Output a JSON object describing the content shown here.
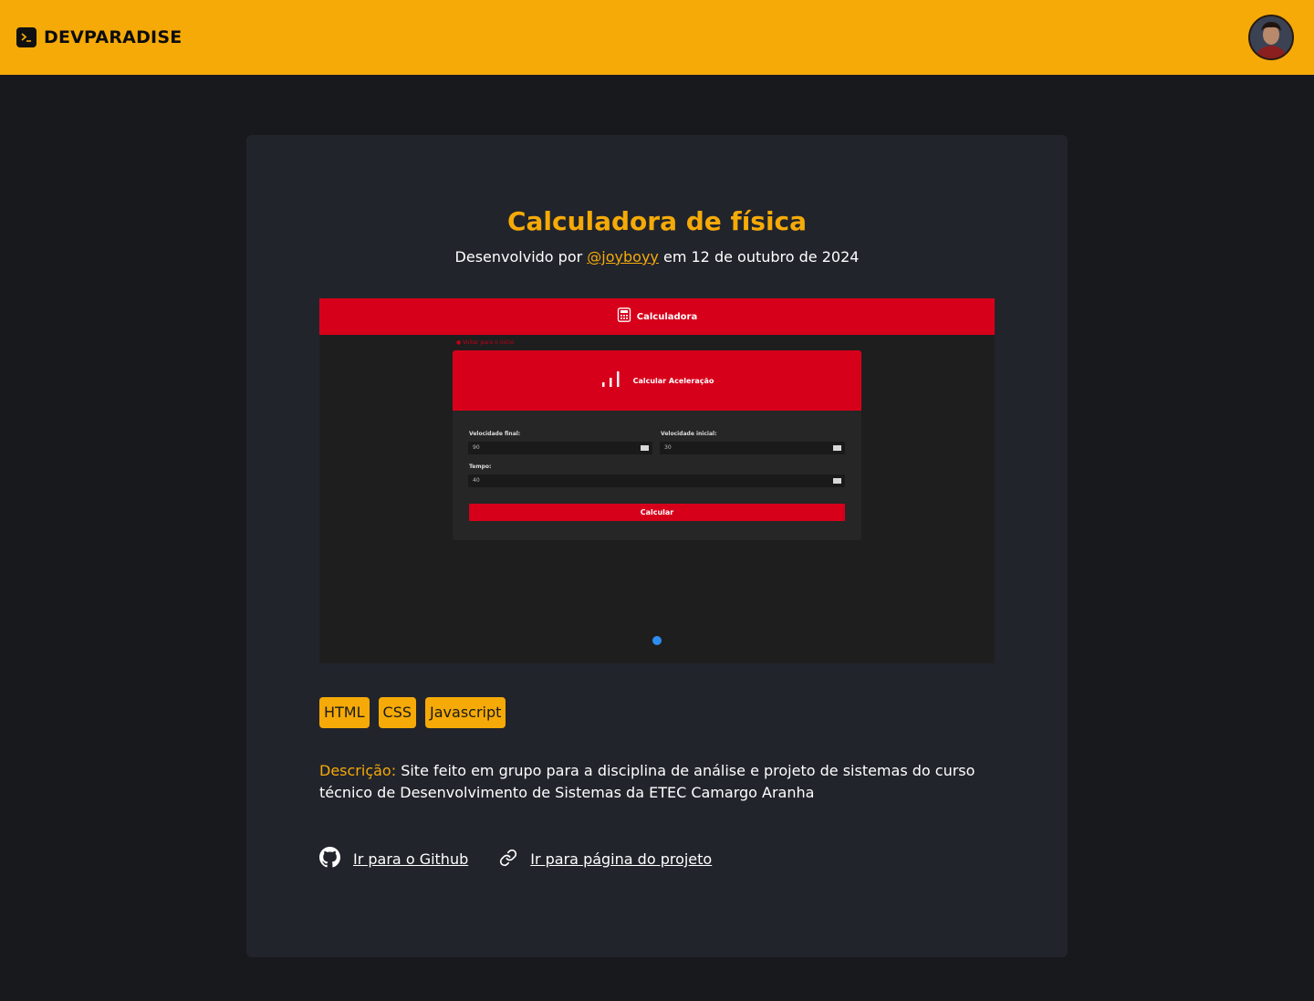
{
  "header": {
    "brand": "DEVPARADISE",
    "colors": {
      "accent": "#f5aa08",
      "background": "#18191d",
      "card": "#22242c"
    }
  },
  "project": {
    "title": "Calculadora de física",
    "byline_prefix": "Desenvolvido por",
    "author": "@joyboyy",
    "byline_suffix": "em 12 de outubro de 2024",
    "preview": {
      "app_title": "Calculadora",
      "back_link": "Voltar para o início",
      "panel_title": "Calcular Aceleração",
      "fields": [
        {
          "label": "Velocidade final:",
          "value": "90"
        },
        {
          "label": "Velocidade inicial:",
          "value": "30"
        },
        {
          "label": "Tempo:",
          "value": "40"
        }
      ],
      "button": "Calcular",
      "colors": {
        "primary": "#d7001b",
        "dot": "#2e8ef0"
      }
    },
    "tags": [
      "HTML",
      "CSS",
      "Javascript"
    ],
    "description_label": "Descrição:",
    "description": "Site feito em grupo para a disciplina de análise e projeto de sistemas do curso técnico de Desenvolvimento de Sistemas da ETEC Camargo Aranha",
    "links": {
      "github": "Ir para o Github",
      "project": "Ir para página do projeto"
    }
  }
}
